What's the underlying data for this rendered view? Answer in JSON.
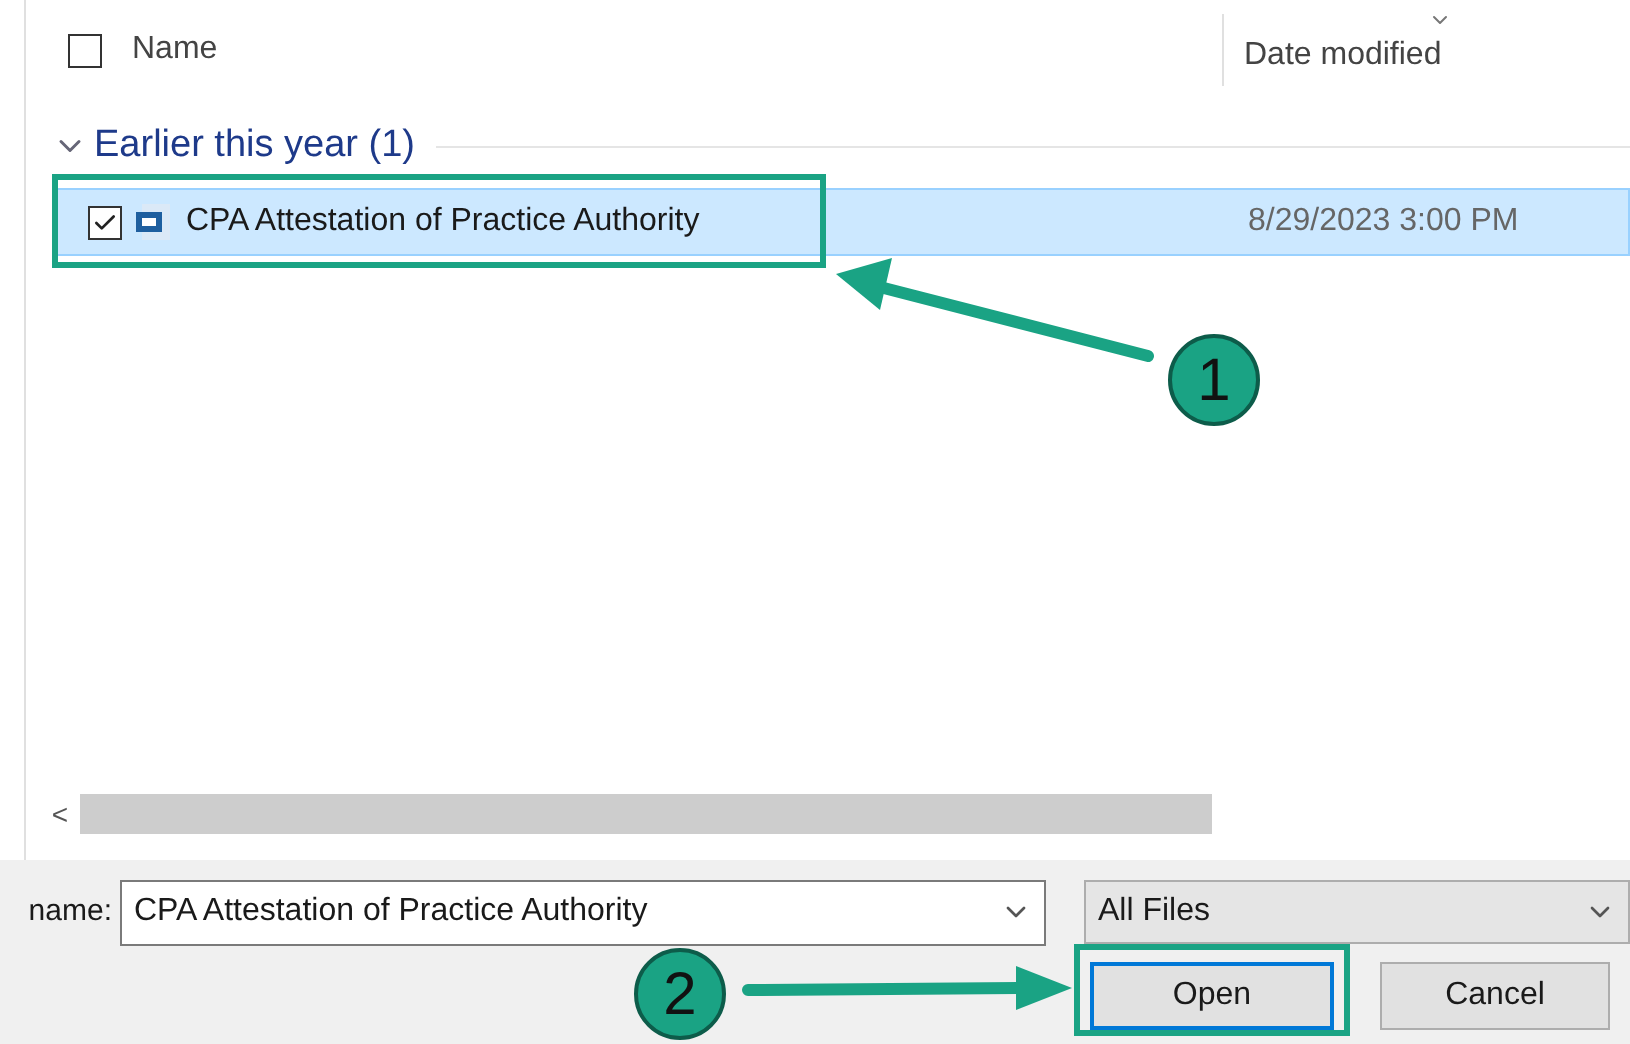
{
  "columns": [
    {
      "label": "Name",
      "sorted": false
    },
    {
      "label": "Date modified",
      "sorted": true
    }
  ],
  "header_checked": false,
  "groups": [
    {
      "label": "Earlier this year (1)",
      "expanded": true,
      "files": [
        {
          "name": "CPA Attestation of Practice Authority",
          "date": "8/29/2023 3:00 PM",
          "selected": true,
          "checked": true
        }
      ]
    }
  ],
  "scroll_left": "<",
  "file_name": {
    "label": "name:",
    "value": "CPA Attestation of Practice Authority"
  },
  "file_type": {
    "value": "All Files"
  },
  "buttons": [
    {
      "label": "Open",
      "focused": true
    },
    {
      "label": "Cancel",
      "focused": false
    }
  ],
  "callouts": [
    "1",
    "2"
  ]
}
